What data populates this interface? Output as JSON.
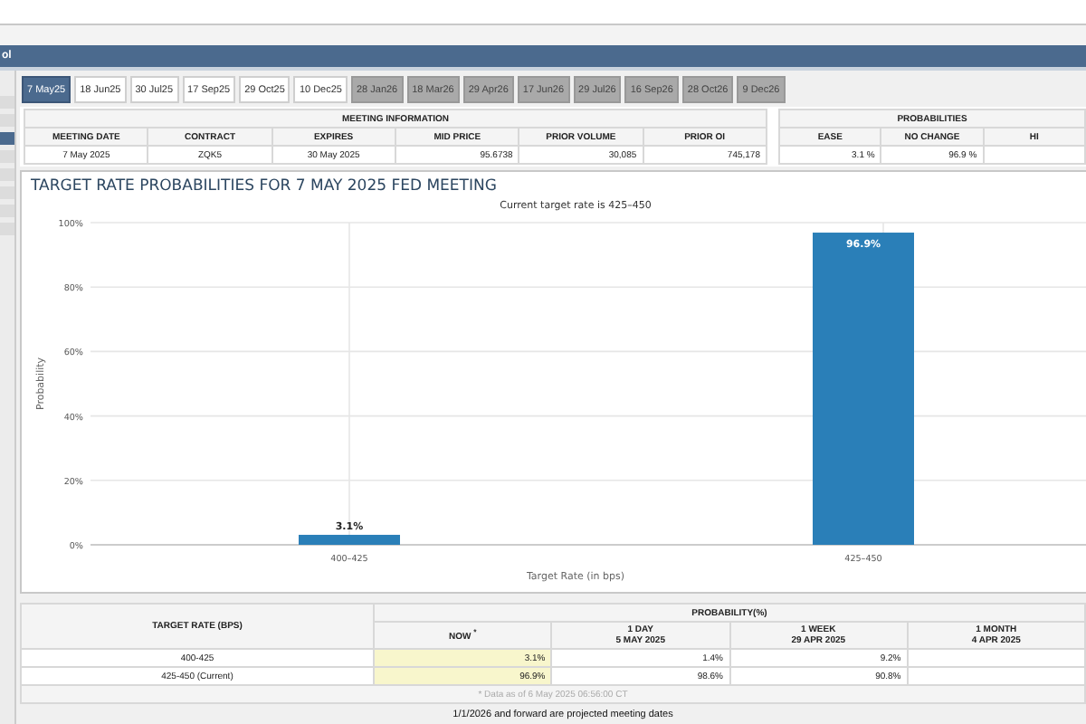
{
  "header": {
    "title": "ol"
  },
  "meeting_tabs": [
    {
      "label": "7 May25",
      "selected": true,
      "projected": false
    },
    {
      "label": "18 Jun25",
      "selected": false,
      "projected": false
    },
    {
      "label": "30 Jul25",
      "selected": false,
      "projected": false
    },
    {
      "label": "17 Sep25",
      "selected": false,
      "projected": false
    },
    {
      "label": "29 Oct25",
      "selected": false,
      "projected": false
    },
    {
      "label": "10 Dec25",
      "selected": false,
      "projected": false
    },
    {
      "label": "28 Jan26",
      "selected": false,
      "projected": true
    },
    {
      "label": "18 Mar26",
      "selected": false,
      "projected": true
    },
    {
      "label": "29 Apr26",
      "selected": false,
      "projected": true
    },
    {
      "label": "17 Jun26",
      "selected": false,
      "projected": true
    },
    {
      "label": "29 Jul26",
      "selected": false,
      "projected": true
    },
    {
      "label": "16 Sep26",
      "selected": false,
      "projected": true
    },
    {
      "label": "28 Oct26",
      "selected": false,
      "projected": true
    },
    {
      "label": "9 Dec26",
      "selected": false,
      "projected": true
    }
  ],
  "meeting_information": {
    "title": "MEETING INFORMATION",
    "columns": [
      "MEETING DATE",
      "CONTRACT",
      "EXPIRES",
      "MID PRICE",
      "PRIOR VOLUME",
      "PRIOR OI"
    ],
    "row": [
      "7 May 2025",
      "ZQK5",
      "30 May 2025",
      "95.6738",
      "30,085",
      "745,178"
    ]
  },
  "probabilities": {
    "title": "PROBABILITIES",
    "columns": [
      "EASE",
      "NO CHANGE",
      "HI"
    ],
    "row": [
      "3.1 %",
      "96.9 %"
    ]
  },
  "chart": {
    "title": "TARGET RATE PROBABILITIES FOR 7 MAY 2025 FED MEETING",
    "subtitle": "Current target rate is 425–450",
    "chart_data": {
      "type": "bar",
      "grid": true,
      "xlabel": "Target Rate (in bps)",
      "ylabel": "Probability",
      "categories": [
        "400–425",
        "425–450"
      ],
      "values": [
        3.1,
        96.9
      ],
      "ylim": [
        0,
        100
      ],
      "yticks": [
        {
          "value": 0,
          "label": "0%"
        },
        {
          "value": 20,
          "label": "20%"
        },
        {
          "value": 40,
          "label": "40%"
        },
        {
          "value": 60,
          "label": "60%"
        },
        {
          "value": 80,
          "label": "80%"
        },
        {
          "value": 100,
          "label": "100%"
        }
      ],
      "value_labels": [
        "3.1%",
        "96.9%"
      ]
    }
  },
  "probability_table": {
    "row_header": "TARGET RATE (BPS)",
    "group_header": "PROBABILITY(%)",
    "columns": [
      {
        "label": "NOW $^{*}$",
        "highlighted": true
      },
      {
        "label": "1 DAY",
        "date": "5 MAY 2025",
        "highlighted": false
      },
      {
        "label": "1 WEEK",
        "date": "29 APR 2025",
        "highlighted": false
      },
      {
        "label": "1 MONTH",
        "date": "4 APR 2025",
        "highlighted": false
      }
    ],
    "rows": [
      {
        "rate": "400-425",
        "values": [
          "3.1%",
          "1.4%",
          "9.2%"
        ]
      },
      {
        "rate": "425-450 (Current)",
        "values": [
          "96.9%",
          "98.6%",
          "90.8%"
        ]
      }
    ],
    "note": "* Data as of 6 May 2025 06:56:00 CT"
  },
  "footer": "1/1/2026 and forward are projected meeting dates"
}
